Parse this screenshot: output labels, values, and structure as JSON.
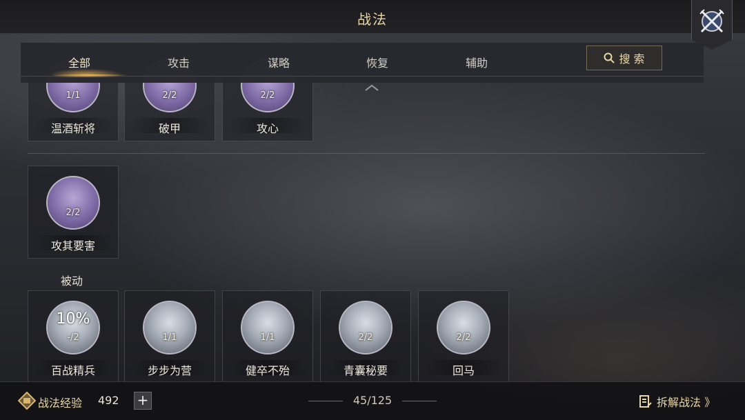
{
  "header": {
    "title": "战法",
    "close_icon": "crossed-swords-icon"
  },
  "tabs": [
    {
      "label": "全部",
      "active": true
    },
    {
      "label": "攻击",
      "active": false
    },
    {
      "label": "谋略",
      "active": false
    },
    {
      "label": "恢复",
      "active": false
    },
    {
      "label": "辅助",
      "active": false
    }
  ],
  "search": {
    "label": "搜 索",
    "icon": "search-icon"
  },
  "top_row": [
    {
      "name": "温酒斩将",
      "level": "1/1",
      "color": "purple"
    },
    {
      "name": "破甲",
      "level": "2/2",
      "color": "purple"
    },
    {
      "name": "攻心",
      "level": "2/2",
      "color": "purple"
    }
  ],
  "single_card": {
    "name": "攻其要害",
    "level": "2/2",
    "color": "purple"
  },
  "passive_section": {
    "title": "被动",
    "cards": [
      {
        "name": "百战精兵",
        "level": "-/2",
        "percent": "10%",
        "color": "gray"
      },
      {
        "name": "步步为营",
        "level": "1/1",
        "color": "gray"
      },
      {
        "name": "健卒不殆",
        "level": "1/1",
        "color": "gray"
      },
      {
        "name": "青囊秘要",
        "level": "2/2",
        "color": "gray"
      },
      {
        "name": "回马",
        "level": "2/2",
        "color": "gray"
      }
    ]
  },
  "footer": {
    "exp_label": "战法经验",
    "exp_value": "492",
    "add_label": "+",
    "count": "45/125",
    "dismantle_label": "拆解战法 》"
  },
  "colors": {
    "accent_gold": "#ead7a8",
    "purple_icon": "#7e6aa5",
    "gray_icon": "#a6acb6"
  }
}
